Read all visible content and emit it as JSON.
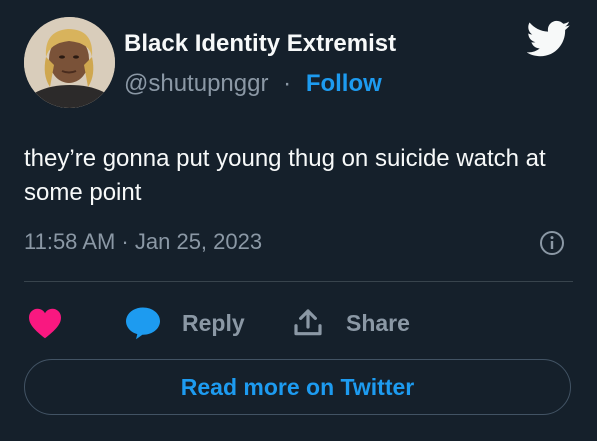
{
  "author": {
    "display_name": "Black Identity Extremist",
    "handle": "@shutupnggr",
    "separator": "·",
    "follow_label": "Follow"
  },
  "tweet": {
    "text": "they’re gonna put young thug on suicide watch at some point",
    "timestamp": "11:58 AM · Jan 25, 2023"
  },
  "actions": {
    "like_icon": "heart-icon",
    "reply_label": "Reply",
    "share_label": "Share"
  },
  "footer": {
    "read_more_label": "Read more on Twitter"
  },
  "colors": {
    "background": "#15202b",
    "accent": "#1d9bf0",
    "like": "#f91880",
    "muted": "#8b98a5"
  }
}
